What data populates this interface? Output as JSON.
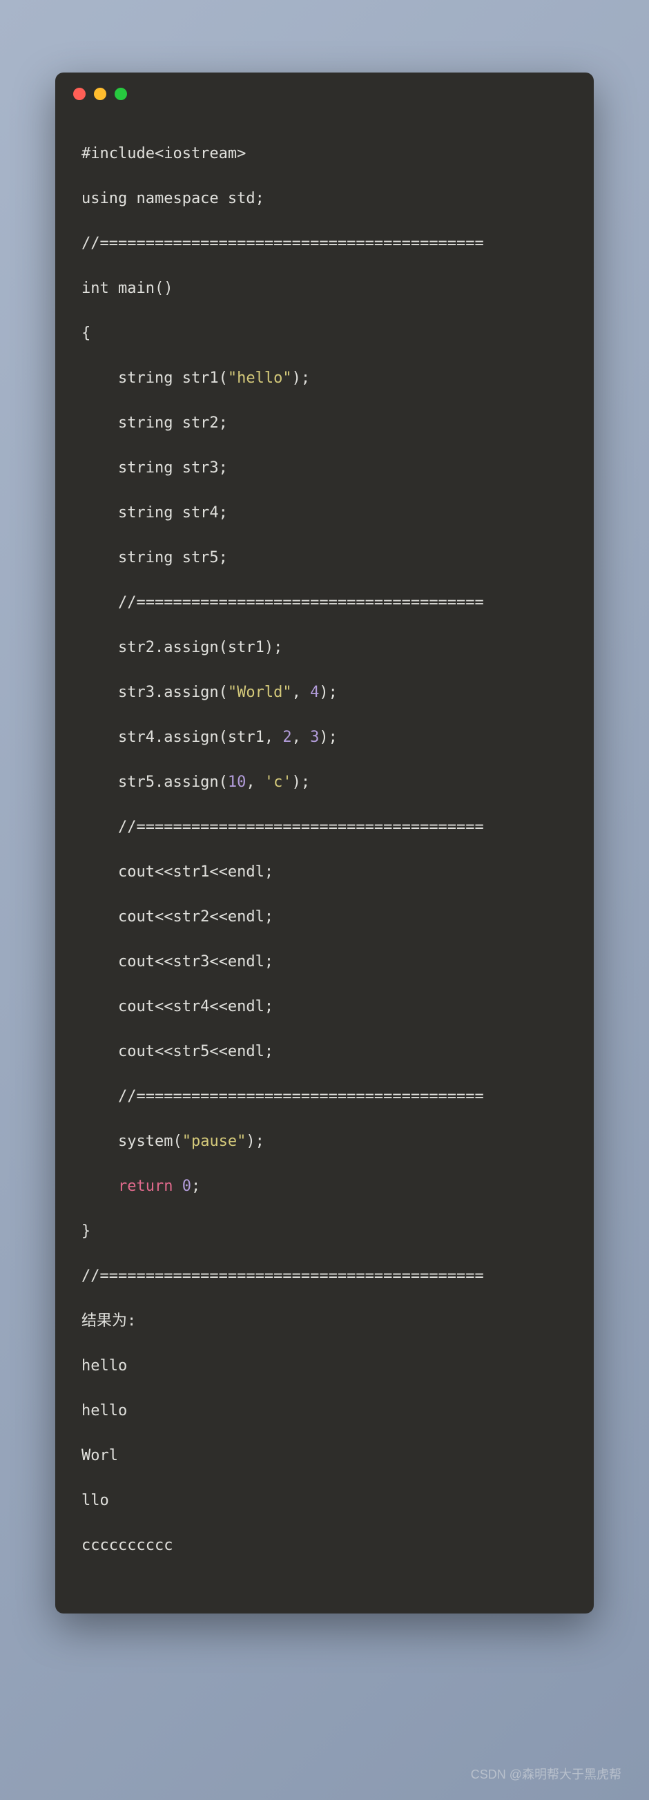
{
  "code": {
    "l1": "#include<iostream>",
    "l2": "using namespace std;",
    "l3": "//==========================================",
    "l4": "int main()",
    "l5": "{",
    "l6_pre": "    string str1(",
    "l6_str": "\"hello\"",
    "l6_post": ");",
    "l7": "    string str2;",
    "l8": "    string str3;",
    "l9": "    string str4;",
    "l10": "    string str5;",
    "l11": "    //======================================",
    "l12": "    str2.assign(str1);",
    "l13_pre": "    str3.assign(",
    "l13_str": "\"World\"",
    "l13_mid": ", ",
    "l13_num": "4",
    "l13_post": ");",
    "l14_pre": "    str4.assign(str1, ",
    "l14_n1": "2",
    "l14_mid": ", ",
    "l14_n2": "3",
    "l14_post": ");",
    "l15_pre": "    str5.assign(",
    "l15_n": "10",
    "l15_mid": ", ",
    "l15_ch": "'c'",
    "l15_post": ");",
    "l16": "    //======================================",
    "l17": "    cout<<str1<<endl;",
    "l18": "    cout<<str2<<endl;",
    "l19": "    cout<<str3<<endl;",
    "l20": "    cout<<str4<<endl;",
    "l21": "    cout<<str5<<endl;",
    "l22": "    //======================================",
    "l23_pre": "    system(",
    "l23_str": "\"pause\"",
    "l23_post": ");",
    "l24_pre": "    ",
    "l24_ret": "return",
    "l24_sp": " ",
    "l24_num": "0",
    "l24_post": ";",
    "l25": "}",
    "l26": "//==========================================",
    "l27": "结果为:",
    "l28": "hello",
    "l29": "hello",
    "l30": "Worl",
    "l31": "llo",
    "l32": "cccccccccc"
  },
  "watermark": "CSDN @森明帮大于黑虎帮"
}
